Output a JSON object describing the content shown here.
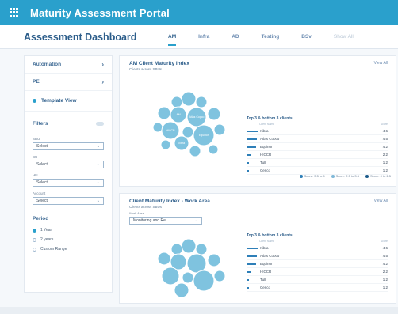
{
  "app": {
    "title": "Maturity Assessment Portal"
  },
  "header": {
    "page_title": "Assessment Dashboard",
    "tabs": [
      {
        "label": "AM",
        "state": "active"
      },
      {
        "label": "Infra",
        "state": "normal"
      },
      {
        "label": "AD",
        "state": "normal"
      },
      {
        "label": "Testing",
        "state": "normal"
      },
      {
        "label": "BSv",
        "state": "normal"
      },
      {
        "label": "Show All",
        "state": "muted"
      }
    ]
  },
  "sidebar": {
    "items": [
      {
        "label": "Automation"
      },
      {
        "label": "PE"
      }
    ],
    "template_view": "Template View",
    "filters_label": "Filters",
    "filters": [
      {
        "label": "SBU",
        "value": "Select"
      },
      {
        "label": "BU",
        "value": "Select"
      },
      {
        "label": "HU",
        "value": "Select"
      },
      {
        "label": "Account",
        "value": "Select"
      }
    ],
    "period_label": "Period",
    "periods": [
      {
        "label": "1 Year",
        "selected": true
      },
      {
        "label": "2 years",
        "selected": false
      },
      {
        "label": "Custom Range",
        "selected": false
      }
    ]
  },
  "cards": [
    {
      "title": "AM Client Maturity Index",
      "subtitle": "Clients across SBUs",
      "view_all": "View All",
      "top_bottom": {
        "title": "Top 3 & bottom 3 clients",
        "col_name": "Client Name",
        "col_score": "Score",
        "rows": [
          {
            "name": "Xibra",
            "score": "4.6"
          },
          {
            "name": "Atlas Copco",
            "score": "4.5"
          },
          {
            "name": "Equinor",
            "score": "4.2"
          },
          {
            "name": "HICCR",
            "score": "2.2"
          },
          {
            "name": "Tull",
            "score": "1.2"
          },
          {
            "name": "Cenco",
            "score": "1.2"
          }
        ]
      },
      "legend": [
        {
          "label": "Score: 3.5 to 5",
          "color": "#2e7fb8"
        },
        {
          "label": "Score: 2.5 to 3.5",
          "color": "#7fb8d8"
        },
        {
          "label": "Score: 0 to 2.5",
          "color": "#1b5a8a"
        }
      ],
      "bubbles": [
        {
          "label": "AM",
          "color": "#7fc3df"
        },
        {
          "label": "Atlas Copco",
          "color": "#7fc3df"
        },
        {
          "label": "Equinor",
          "color": "#7fc3df"
        },
        {
          "label": "HICCR",
          "color": "#7fc3df"
        },
        {
          "label": "Xibra",
          "color": "#7fc3df"
        }
      ]
    },
    {
      "title": "Client Maturity Index - Work Area",
      "subtitle": "Clients across SBUs",
      "view_all": "View All",
      "work_area_label": "Work Area",
      "work_area_value": "Monitoring and Re...",
      "top_bottom": {
        "title": "Top 3 & bottom 3 clients",
        "col_name": "Client Name",
        "col_score": "Score",
        "rows": [
          {
            "name": "Xibra",
            "score": "4.6"
          },
          {
            "name": "Atlas Copco",
            "score": "4.5"
          },
          {
            "name": "Equinor",
            "score": "4.2"
          },
          {
            "name": "HICCR",
            "score": "2.2"
          },
          {
            "name": "Tull",
            "score": "1.2"
          },
          {
            "name": "Cenco",
            "score": "1.2"
          }
        ]
      }
    }
  ]
}
